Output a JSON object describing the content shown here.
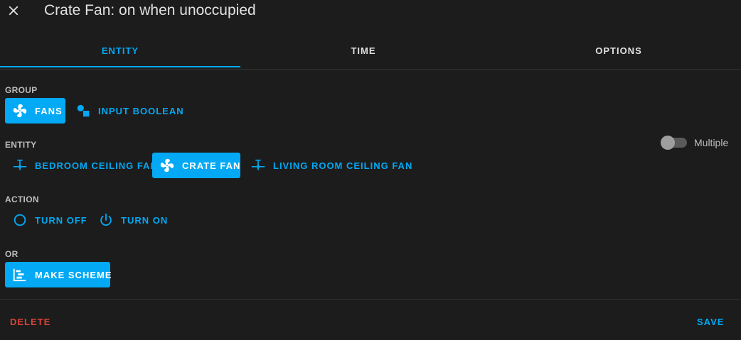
{
  "dialog": {
    "title": "Crate Fan: on when unoccupied"
  },
  "tabs": [
    {
      "label": "ENTITY",
      "active": true
    },
    {
      "label": "TIME",
      "active": false
    },
    {
      "label": "OPTIONS",
      "active": false
    }
  ],
  "group": {
    "label": "GROUP",
    "chips": [
      {
        "label": "FANS",
        "icon": "fan-icon",
        "selected": true
      },
      {
        "label": "INPUT BOOLEAN",
        "icon": "input-boolean-icon",
        "selected": false
      }
    ]
  },
  "entity": {
    "label": "ENTITY",
    "multiple_label": "Multiple",
    "multiple_enabled": false,
    "chips": [
      {
        "label": "BEDROOM CEILING FAN",
        "icon": "ceiling-fan-icon",
        "selected": false
      },
      {
        "label": "CRATE FAN",
        "icon": "fan-icon",
        "selected": true
      },
      {
        "label": "LIVING ROOM CEILING FAN",
        "icon": "ceiling-fan-icon",
        "selected": false
      }
    ]
  },
  "action": {
    "label": "ACTION",
    "chips": [
      {
        "label": "TURN OFF",
        "icon": "circle-outline-icon",
        "selected": false
      },
      {
        "label": "TURN ON",
        "icon": "power-icon",
        "selected": false
      }
    ]
  },
  "or_section": {
    "label": "OR",
    "scheme_button": {
      "label": "MAKE SCHEME",
      "icon": "chart-gantt-icon"
    }
  },
  "footer": {
    "delete_label": "DELETE",
    "save_label": "SAVE"
  },
  "colors": {
    "accent": "#03a9f4",
    "danger": "#db4437",
    "background": "#1c1c1c"
  }
}
